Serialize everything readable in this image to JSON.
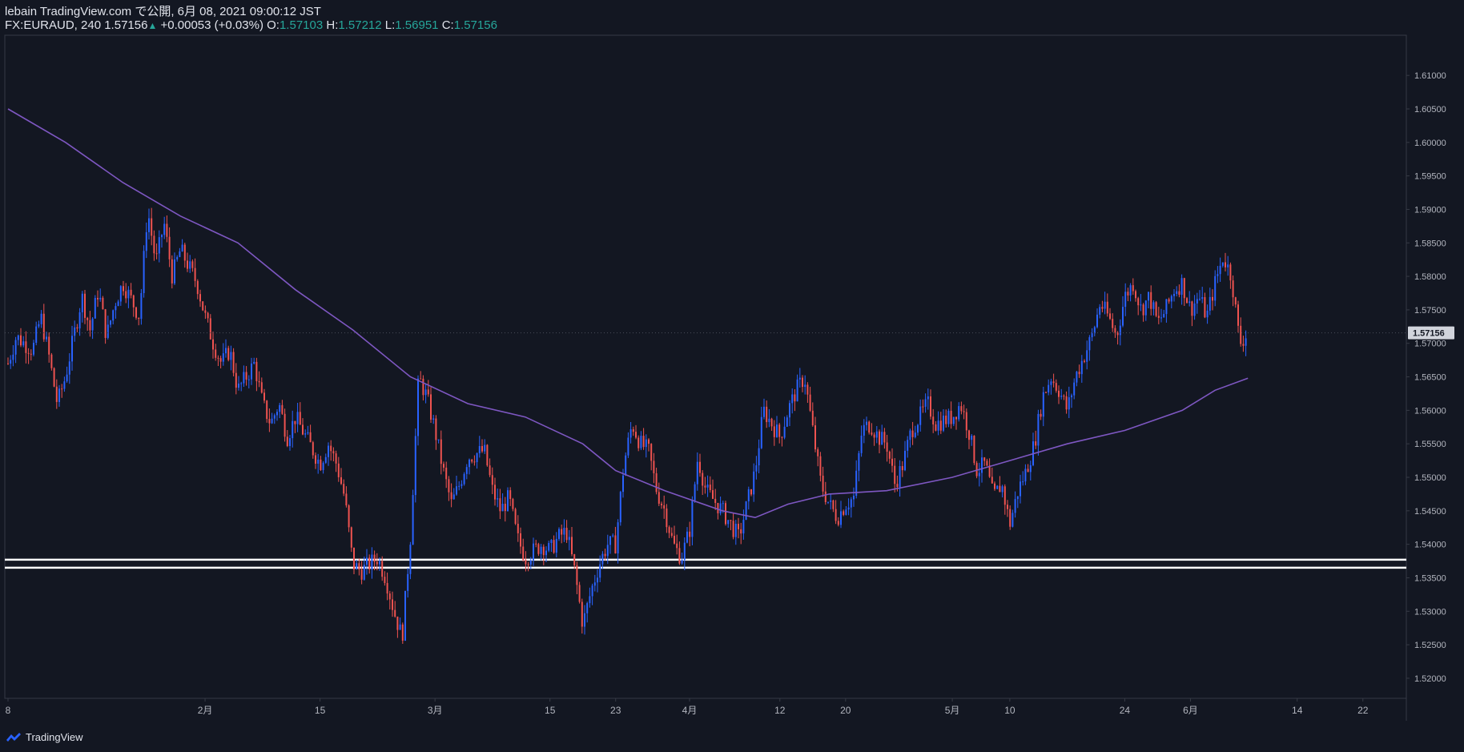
{
  "header": {
    "publish_line": "lebain TradingView.com で公開, 6月 08, 2021 09:00:12 JST",
    "symbol": "FX:EURAUD, 240",
    "last": "1.57156",
    "change": "+0.00053 (+0.03%)",
    "o_label": "O:",
    "o_value": "1.57103",
    "h_label": "H:",
    "h_value": "1.57212",
    "l_label": "L:",
    "l_value": "1.56951",
    "c_label": "C:",
    "c_value": "1.57156"
  },
  "footer": {
    "brand": "TradingView"
  },
  "colors": {
    "background": "#131722",
    "up": "#2962ff",
    "down": "#ef5350",
    "ma": "#7e57c2",
    "support": "#ffffff",
    "grid": "#363a45",
    "text": "#b2b5be"
  },
  "chart_data": {
    "type": "candlestick",
    "symbol": "FX:EURAUD",
    "timeframe": "240",
    "ylim": [
      1.517,
      1.616
    ],
    "yticks": [
      "1.61000",
      "1.60500",
      "1.60000",
      "1.59500",
      "1.59000",
      "1.58500",
      "1.58000",
      "1.57500",
      "1.57000",
      "1.56500",
      "1.56000",
      "1.55500",
      "1.55000",
      "1.54500",
      "1.54000",
      "1.53500",
      "1.53000",
      "1.52500",
      "1.52000"
    ],
    "current_price_label": "1.57156",
    "x_ticks": [
      {
        "label": "8",
        "date": "2021-01-08"
      },
      {
        "label": "2月",
        "date": "2021-02-01"
      },
      {
        "label": "15",
        "date": "2021-02-15"
      },
      {
        "label": "3月",
        "date": "2021-03-01"
      },
      {
        "label": "15",
        "date": "2021-03-15"
      },
      {
        "label": "23",
        "date": "2021-03-23"
      },
      {
        "label": "4月",
        "date": "2021-04-01"
      },
      {
        "label": "12",
        "date": "2021-04-12"
      },
      {
        "label": "20",
        "date": "2021-04-20"
      },
      {
        "label": "5月",
        "date": "2021-05-03"
      },
      {
        "label": "10",
        "date": "2021-05-10"
      },
      {
        "label": "24",
        "date": "2021-05-24"
      },
      {
        "label": "6月",
        "date": "2021-06-01"
      },
      {
        "label": "14",
        "date": "2021-06-14"
      },
      {
        "label": "22",
        "date": "2021-06-22"
      }
    ],
    "price_path": [
      [
        "2021-01-08",
        1.567
      ],
      [
        "2021-01-09",
        1.571
      ],
      [
        "2021-01-11",
        1.569
      ],
      [
        "2021-01-12",
        1.574
      ],
      [
        "2021-01-13",
        1.568
      ],
      [
        "2021-01-14",
        1.561
      ],
      [
        "2021-01-15",
        1.565
      ],
      [
        "2021-01-17",
        1.577
      ],
      [
        "2021-01-18",
        1.572
      ],
      [
        "2021-01-19",
        1.578
      ],
      [
        "2021-01-20",
        1.571
      ],
      [
        "2021-01-21",
        1.576
      ],
      [
        "2021-01-22",
        1.579
      ],
      [
        "2021-01-24",
        1.574
      ],
      [
        "2021-01-25",
        1.59
      ],
      [
        "2021-01-26",
        1.582
      ],
      [
        "2021-01-27",
        1.588
      ],
      [
        "2021-01-28",
        1.58
      ],
      [
        "2021-01-29",
        1.584
      ],
      [
        "2021-01-31",
        1.579
      ],
      [
        "2021-02-01",
        1.574
      ],
      [
        "2021-02-02",
        1.57
      ],
      [
        "2021-02-03",
        1.567
      ],
      [
        "2021-02-04",
        1.569
      ],
      [
        "2021-02-05",
        1.563
      ],
      [
        "2021-02-07",
        1.567
      ],
      [
        "2021-02-08",
        1.561
      ],
      [
        "2021-02-09",
        1.558
      ],
      [
        "2021-02-10",
        1.561
      ],
      [
        "2021-02-11",
        1.556
      ],
      [
        "2021-02-12",
        1.559
      ],
      [
        "2021-02-15",
        1.552
      ],
      [
        "2021-02-16",
        1.555
      ],
      [
        "2021-02-17",
        1.552
      ],
      [
        "2021-02-18",
        1.547
      ],
      [
        "2021-02-19",
        1.537
      ],
      [
        "2021-02-20",
        1.536
      ],
      [
        "2021-02-22",
        1.538
      ],
      [
        "2021-02-23",
        1.535
      ],
      [
        "2021-02-24",
        1.53
      ],
      [
        "2021-02-25",
        1.526
      ],
      [
        "2021-02-26",
        1.541
      ],
      [
        "2021-02-27",
        1.565
      ],
      [
        "2021-02-28",
        1.562
      ],
      [
        "2021-03-01",
        1.557
      ],
      [
        "2021-03-02",
        1.551
      ],
      [
        "2021-03-03",
        1.546
      ],
      [
        "2021-03-04",
        1.549
      ],
      [
        "2021-03-05",
        1.553
      ],
      [
        "2021-03-07",
        1.554
      ],
      [
        "2021-03-08",
        1.548
      ],
      [
        "2021-03-09",
        1.545
      ],
      [
        "2021-03-10",
        1.547
      ],
      [
        "2021-03-11",
        1.541
      ],
      [
        "2021-03-12",
        1.538
      ],
      [
        "2021-03-14",
        1.54
      ],
      [
        "2021-03-15",
        1.539
      ],
      [
        "2021-03-16",
        1.541
      ],
      [
        "2021-03-17",
        1.542
      ],
      [
        "2021-03-18",
        1.536
      ],
      [
        "2021-03-19",
        1.528
      ],
      [
        "2021-03-20",
        1.533
      ],
      [
        "2021-03-21",
        1.537
      ],
      [
        "2021-03-22",
        1.54
      ],
      [
        "2021-03-23",
        1.54
      ],
      [
        "2021-03-24",
        1.552
      ],
      [
        "2021-03-25",
        1.558
      ],
      [
        "2021-03-26",
        1.555
      ],
      [
        "2021-03-27",
        1.554
      ],
      [
        "2021-03-28",
        1.548
      ],
      [
        "2021-03-29",
        1.545
      ],
      [
        "2021-03-30",
        1.54
      ],
      [
        "2021-03-31",
        1.538
      ],
      [
        "2021-04-01",
        1.542
      ],
      [
        "2021-04-02",
        1.553
      ],
      [
        "2021-04-03",
        1.548
      ],
      [
        "2021-04-05",
        1.545
      ],
      [
        "2021-04-06",
        1.543
      ],
      [
        "2021-04-07",
        1.541
      ],
      [
        "2021-04-08",
        1.546
      ],
      [
        "2021-04-09",
        1.551
      ],
      [
        "2021-04-10",
        1.56
      ],
      [
        "2021-04-12",
        1.556
      ],
      [
        "2021-04-13",
        1.56
      ],
      [
        "2021-04-14",
        1.563
      ],
      [
        "2021-04-15",
        1.565
      ],
      [
        "2021-04-16",
        1.557
      ],
      [
        "2021-04-17",
        1.549
      ],
      [
        "2021-04-18",
        1.546
      ],
      [
        "2021-04-19",
        1.544
      ],
      [
        "2021-04-20",
        1.546
      ],
      [
        "2021-04-21",
        1.547
      ],
      [
        "2021-04-22",
        1.557
      ],
      [
        "2021-04-23",
        1.558
      ],
      [
        "2021-04-24",
        1.556
      ],
      [
        "2021-04-25",
        1.555
      ],
      [
        "2021-04-26",
        1.549
      ],
      [
        "2021-04-27",
        1.552
      ],
      [
        "2021-04-28",
        1.557
      ],
      [
        "2021-04-29",
        1.559
      ],
      [
        "2021-04-30",
        1.561
      ],
      [
        "2021-05-01",
        1.558
      ],
      [
        "2021-05-03",
        1.559
      ],
      [
        "2021-05-04",
        1.561
      ],
      [
        "2021-05-05",
        1.557
      ],
      [
        "2021-05-06",
        1.551
      ],
      [
        "2021-05-07",
        1.552
      ],
      [
        "2021-05-08",
        1.547
      ],
      [
        "2021-05-09",
        1.549
      ],
      [
        "2021-05-10",
        1.543
      ],
      [
        "2021-05-11",
        1.548
      ],
      [
        "2021-05-12",
        1.551
      ],
      [
        "2021-05-13",
        1.555
      ],
      [
        "2021-05-14",
        1.562
      ],
      [
        "2021-05-15",
        1.565
      ],
      [
        "2021-05-16",
        1.563
      ],
      [
        "2021-05-17",
        1.56
      ],
      [
        "2021-05-18",
        1.565
      ],
      [
        "2021-05-19",
        1.568
      ],
      [
        "2021-05-20",
        1.571
      ],
      [
        "2021-05-21",
        1.576
      ],
      [
        "2021-05-22",
        1.574
      ],
      [
        "2021-05-23",
        1.571
      ],
      [
        "2021-05-24",
        1.577
      ],
      [
        "2021-05-25",
        1.579
      ],
      [
        "2021-05-26",
        1.575
      ],
      [
        "2021-05-27",
        1.577
      ],
      [
        "2021-05-28",
        1.573
      ],
      [
        "2021-05-29",
        1.575
      ],
      [
        "2021-05-30",
        1.578
      ],
      [
        "2021-05-31",
        1.579
      ],
      [
        "2021-06-01",
        1.575
      ],
      [
        "2021-06-02",
        1.577
      ],
      [
        "2021-06-03",
        1.574
      ],
      [
        "2021-06-04",
        1.579
      ],
      [
        "2021-06-05",
        1.583
      ],
      [
        "2021-06-06",
        1.58
      ],
      [
        "2021-06-07",
        1.57
      ],
      [
        "2021-06-08",
        1.5716
      ]
    ],
    "ma_line": [
      [
        "2021-01-08",
        1.605
      ],
      [
        "2021-01-15",
        1.6
      ],
      [
        "2021-01-22",
        1.594
      ],
      [
        "2021-01-29",
        1.589
      ],
      [
        "2021-02-05",
        1.585
      ],
      [
        "2021-02-12",
        1.578
      ],
      [
        "2021-02-19",
        1.572
      ],
      [
        "2021-02-26",
        1.565
      ],
      [
        "2021-03-05",
        1.561
      ],
      [
        "2021-03-12",
        1.559
      ],
      [
        "2021-03-19",
        1.555
      ],
      [
        "2021-03-23",
        1.551
      ],
      [
        "2021-03-29",
        1.548
      ],
      [
        "2021-04-05",
        1.545
      ],
      [
        "2021-04-09",
        1.544
      ],
      [
        "2021-04-13",
        1.546
      ],
      [
        "2021-04-18",
        1.5475
      ],
      [
        "2021-04-25",
        1.548
      ],
      [
        "2021-05-03",
        1.55
      ],
      [
        "2021-05-10",
        1.5525
      ],
      [
        "2021-05-17",
        1.555
      ],
      [
        "2021-05-24",
        1.557
      ],
      [
        "2021-05-31",
        1.56
      ],
      [
        "2021-06-04",
        1.563
      ],
      [
        "2021-06-08",
        1.5648
      ]
    ],
    "horizontal_lines": [
      1.5377,
      1.5365
    ]
  }
}
